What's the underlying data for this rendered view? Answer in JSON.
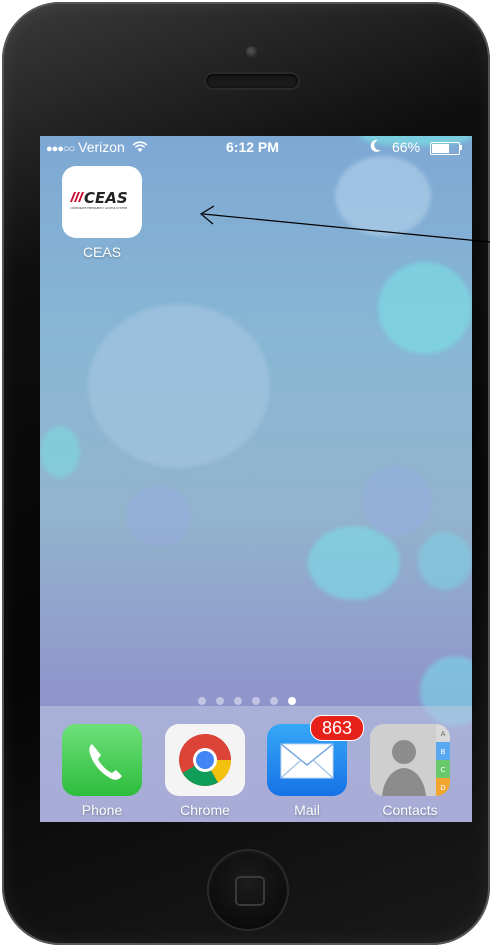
{
  "status_bar": {
    "signal": "●●●○○",
    "carrier": "Verizon",
    "time": "6:12 PM",
    "battery_percent": "66%",
    "icons": [
      "wifi-icon",
      "moon-icon",
      "battery-icon"
    ]
  },
  "home_apps": [
    {
      "label": "CEAS",
      "logo_text": "CEAS",
      "logo_subtext": "CORPORATE EMERGENCY ACCESS SYSTEM",
      "icon": "ceas-logo-icon"
    }
  ],
  "page_dots": {
    "count": 6,
    "active_index": 5
  },
  "dock": {
    "apps": [
      {
        "label": "Phone",
        "icon": "phone-icon"
      },
      {
        "label": "Chrome",
        "icon": "chrome-icon"
      },
      {
        "label": "Mail",
        "icon": "mail-icon",
        "badge": "863"
      },
      {
        "label": "Contacts",
        "icon": "contacts-icon",
        "tabs": [
          "A",
          "B",
          "C",
          "D"
        ]
      }
    ]
  },
  "colors": {
    "badge": "#e8201a",
    "phone": "#4cd964",
    "mail": "#1d8bf2",
    "ceas_red": "#c8102e"
  }
}
